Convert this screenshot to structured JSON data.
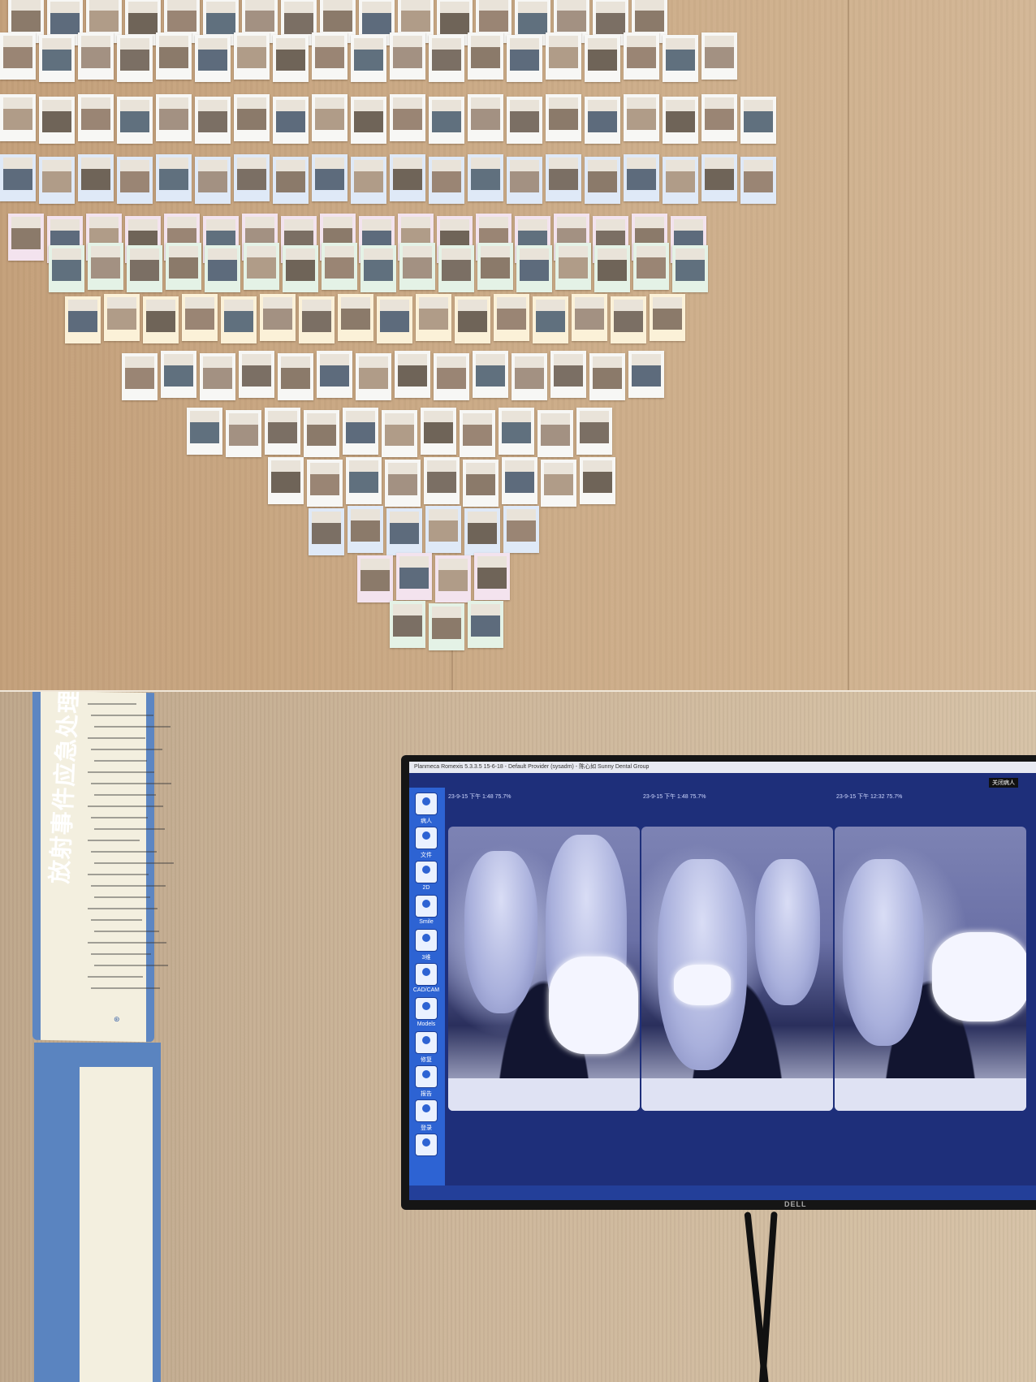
{
  "poster": {
    "title": "放射事件应急处理预案"
  },
  "monitor": {
    "window_title": "Planmeca Romexis 5.3.3.5 15-6-18 - Default Provider (sysadm) - 陈心如 Sunny Dental Group",
    "close_patient_label": "关闭病人",
    "brand": "DELL",
    "panes": [
      {
        "header": "23-9-15 下午 1:48 75.7%"
      },
      {
        "header": "23-9-15 下午 1:48 75.7%"
      },
      {
        "header": "23-9-15 下午 12:32 75.7%"
      }
    ],
    "sidebar": [
      {
        "label": "病人",
        "icon": "patients-icon"
      },
      {
        "label": "文件",
        "icon": "file-icon"
      },
      {
        "label": "2D",
        "icon": "2d-icon"
      },
      {
        "label": "Smile",
        "icon": "smile-icon"
      },
      {
        "label": "3维",
        "icon": "3d-icon"
      },
      {
        "label": "CAD/CAM",
        "icon": "cadcam-icon"
      },
      {
        "label": "Models",
        "icon": "models-icon"
      },
      {
        "label": "修复",
        "icon": "implant-icon"
      },
      {
        "label": "报告",
        "icon": "report-icon"
      },
      {
        "label": "登录",
        "icon": "login-icon"
      },
      {
        "label": "",
        "icon": "user-icon"
      }
    ]
  }
}
